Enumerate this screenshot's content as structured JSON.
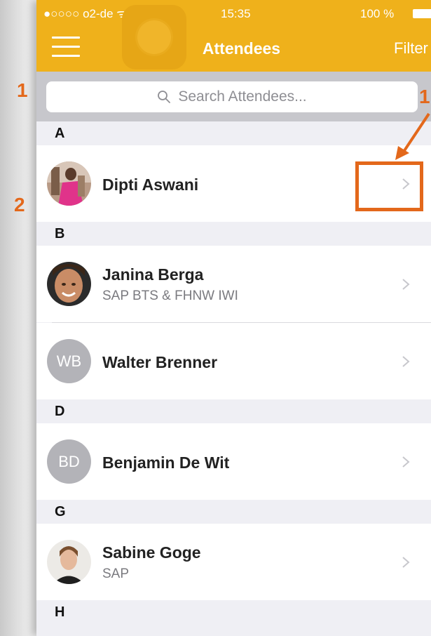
{
  "status_bar": {
    "carrier": "●○○○○ o2-de ᯤ",
    "time": "15:35",
    "battery": "100 %"
  },
  "nav": {
    "title": "Attendees",
    "filter_label": "Filter"
  },
  "search": {
    "placeholder": "Search Attendees..."
  },
  "sections": [
    {
      "letter": "A",
      "rows": [
        {
          "name": "Dipti Aswani",
          "subtitle": "",
          "avatar": "photo",
          "avatar_icon": "photo-avatar-icon"
        }
      ]
    },
    {
      "letter": "B",
      "rows": [
        {
          "name": "Janina Berga",
          "subtitle": "SAP BTS & FHNW IWI",
          "avatar": "photo",
          "avatar_icon": "photo-avatar-icon"
        },
        {
          "name": "Walter Brenner",
          "subtitle": "",
          "avatar": "initials",
          "initials": "WB"
        }
      ]
    },
    {
      "letter": "D",
      "rows": [
        {
          "name": "Benjamin De Wit",
          "subtitle": "",
          "avatar": "initials",
          "initials": "BD"
        }
      ]
    },
    {
      "letter": "G",
      "rows": [
        {
          "name": "Sabine Goge",
          "subtitle": "SAP",
          "avatar": "photo",
          "avatar_icon": "photo-avatar-icon"
        }
      ]
    },
    {
      "letter": "H",
      "rows": []
    }
  ],
  "annotations": {
    "label_1_left": "1",
    "label_2_left": "2",
    "label_1_right": "1",
    "color": "#e3681b"
  },
  "colors": {
    "nav_bar": "#efb11b",
    "background": "#efeff4"
  }
}
